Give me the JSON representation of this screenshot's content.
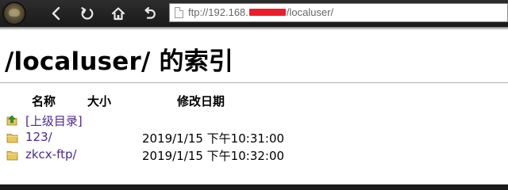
{
  "browser": {
    "url_prefix": "ftp://192.168.",
    "url_suffix": "/localuser/"
  },
  "toolbar": {
    "icons": [
      "browser-logo",
      "back-icon",
      "refresh-icon",
      "home-icon",
      "undo-icon"
    ]
  },
  "page": {
    "title": "/localuser/ 的索引",
    "columns": {
      "name": "名称",
      "size": "大小",
      "modified": "修改日期"
    },
    "rows": [
      {
        "icon": "up-folder-icon",
        "name": "[上级目录]",
        "size": "",
        "modified": ""
      },
      {
        "icon": "folder-icon",
        "name": "123/",
        "size": "",
        "modified": "2019/1/15 下午10:31:00"
      },
      {
        "icon": "folder-icon",
        "name": "zkcx-ftp/",
        "size": "",
        "modified": "2019/1/15 下午10:32:00"
      }
    ]
  },
  "colors": {
    "link": "#4a2a86",
    "toolbar": "#1f1f1f",
    "redaction": "#ee1c2a",
    "folder": "#e8c65a"
  }
}
